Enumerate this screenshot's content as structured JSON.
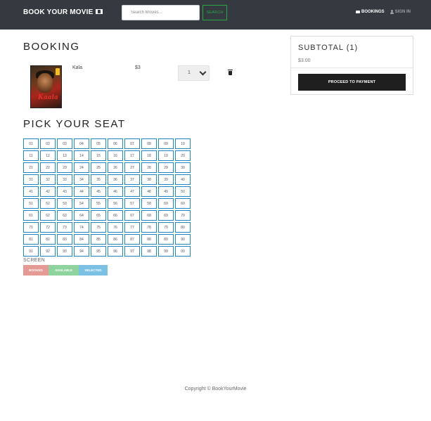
{
  "navbar": {
    "brand": "BOOK YOUR MOVIE",
    "brand_icon": "film-icon",
    "search_placeholder": "Search Movies...",
    "search_button": "SEARCH",
    "bookings_label": "BOOKINGS",
    "signin_label": "SIGN IN"
  },
  "booking": {
    "title": "BOOKING",
    "item": {
      "poster_text": "Kaala",
      "name": "Kala",
      "price": "$3",
      "quantity": "1"
    }
  },
  "summary": {
    "title": "SUBTOTAL (1)",
    "amount": "$3.00",
    "pay_button": "PROCEED TO PAYMENT"
  },
  "seats": {
    "title": "PICK YOUR SEAT",
    "rows": [
      [
        "01",
        "02",
        "03",
        "04",
        "05",
        "06",
        "07",
        "08",
        "09",
        "10"
      ],
      [
        "11",
        "12",
        "13",
        "14",
        "15",
        "16",
        "17",
        "18",
        "19",
        "20"
      ],
      [
        "21",
        "22",
        "23",
        "24",
        "25",
        "26",
        "27",
        "28",
        "29",
        "30"
      ],
      [
        "31",
        "32",
        "33",
        "34",
        "35",
        "36",
        "37",
        "38",
        "39",
        "40"
      ],
      [
        "41",
        "42",
        "43",
        "44",
        "45",
        "46",
        "47",
        "48",
        "49",
        "50"
      ],
      [
        "51",
        "52",
        "53",
        "54",
        "55",
        "56",
        "57",
        "58",
        "59",
        "60"
      ],
      [
        "61",
        "62",
        "63",
        "64",
        "65",
        "66",
        "67",
        "68",
        "69",
        "70"
      ],
      [
        "71",
        "72",
        "73",
        "74",
        "75",
        "76",
        "77",
        "78",
        "79",
        "80"
      ],
      [
        "81",
        "82",
        "83",
        "84",
        "85",
        "86",
        "87",
        "88",
        "89",
        "90"
      ],
      [
        "91",
        "92",
        "93",
        "94",
        "95",
        "96",
        "97",
        "98",
        "99",
        "00"
      ]
    ],
    "screen_label": "SCREEN",
    "legend": {
      "booked": "BOOKED",
      "available": "AVAILABLE",
      "selected": "SELECTED"
    }
  },
  "colors": {
    "navbar": "#343a40",
    "accent_green": "#28a745",
    "seat_border": "#1f86c6",
    "booked": "#e59a96",
    "available": "#8fd39e",
    "selected": "#7cc0e4"
  },
  "footer": "Copyright © BookYourMovie"
}
